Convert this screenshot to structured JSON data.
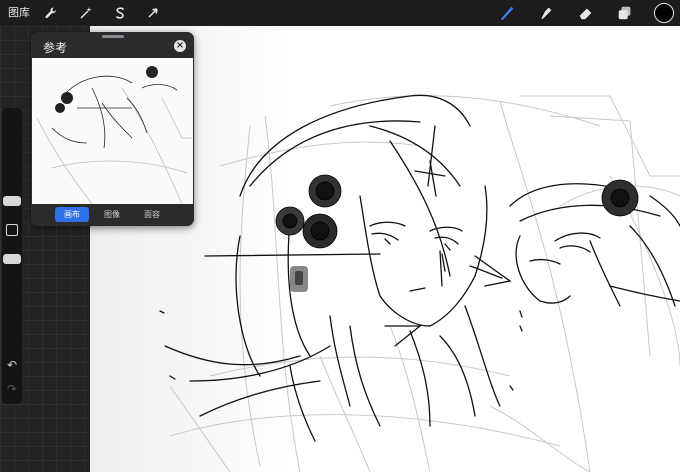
{
  "topbar": {
    "gallery_label": "图库",
    "left_tools": [
      {
        "name": "actions",
        "icon": "wrench-icon"
      },
      {
        "name": "adjustments",
        "icon": "magic-wand-icon"
      },
      {
        "name": "selection",
        "icon": "selection-s-icon"
      },
      {
        "name": "transform",
        "icon": "arrow-cursor-icon"
      }
    ],
    "right_tools": [
      {
        "name": "brush",
        "icon": "brush-icon",
        "active": true
      },
      {
        "name": "smudge",
        "icon": "smudge-icon"
      },
      {
        "name": "eraser",
        "icon": "eraser-icon"
      },
      {
        "name": "layers",
        "icon": "layers-icon"
      }
    ],
    "active_color": "#000000",
    "active_tool_color": "#3b82f6"
  },
  "sidebar": {
    "undo_icon": "undo-icon",
    "redo_icon": "redo-icon",
    "modify_icon": "square-modify-icon"
  },
  "reference": {
    "title": "参考",
    "close_icon": "close-icon",
    "tabs": [
      {
        "label": "画布",
        "active": true
      },
      {
        "label": "图像",
        "active": false
      },
      {
        "label": "面容",
        "active": false
      }
    ]
  }
}
